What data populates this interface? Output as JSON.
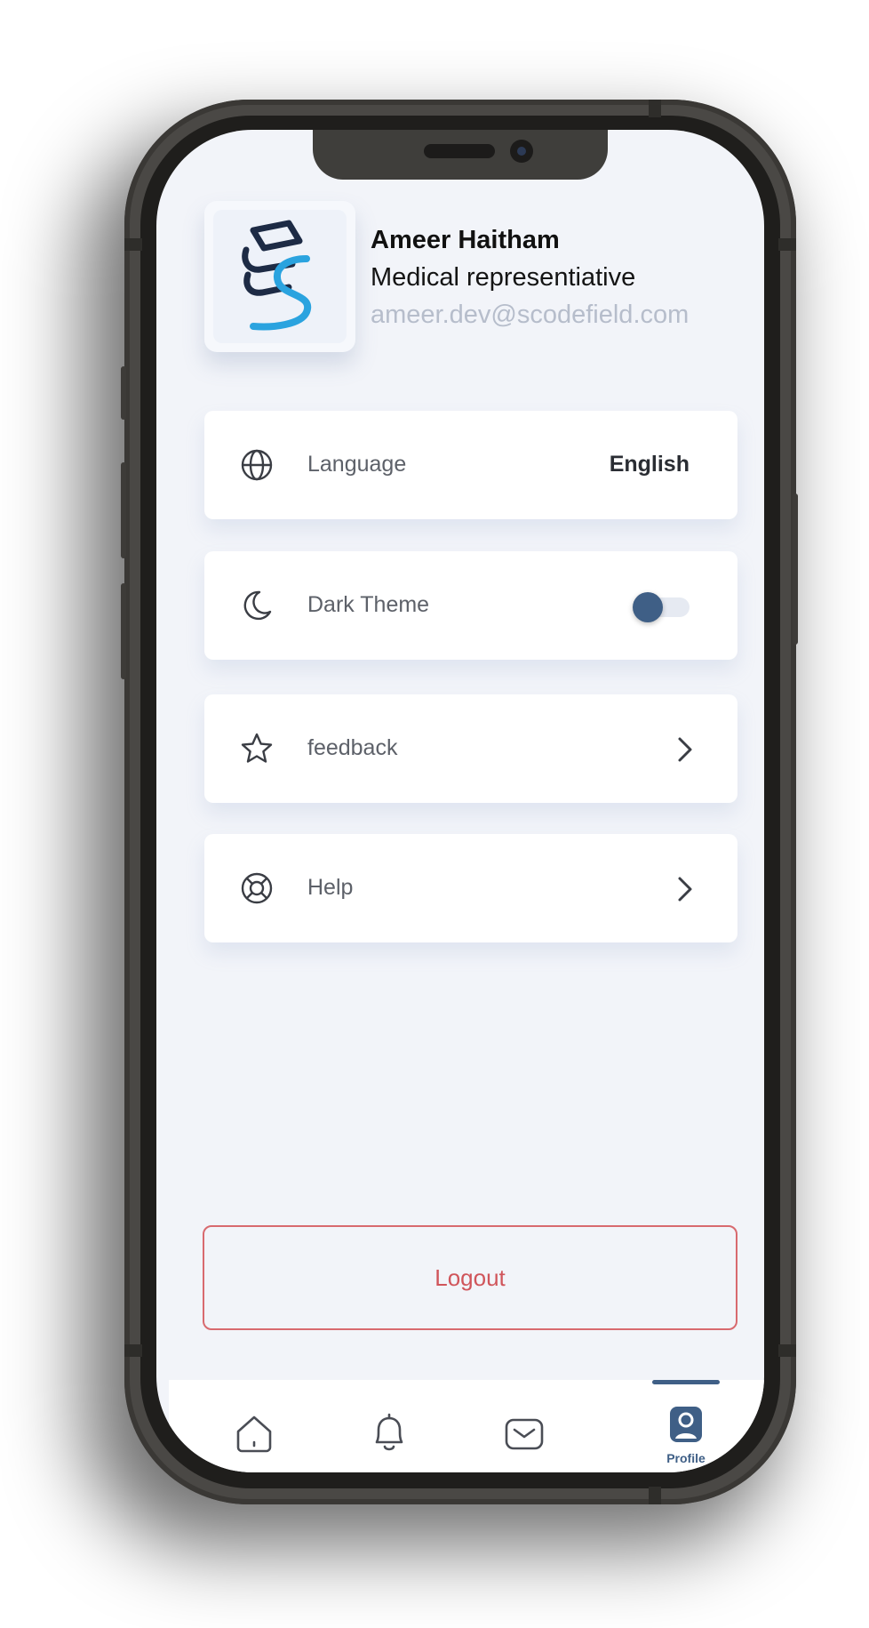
{
  "profile": {
    "name": "Ameer Haitham",
    "role": "Medical representiative",
    "email": "ameer.dev@scodefield.com"
  },
  "settings": [
    {
      "label": "Language",
      "value": "English",
      "icon": "globe-icon"
    },
    {
      "label": "Dark Theme",
      "icon": "moon-icon",
      "toggle_on": false
    },
    {
      "label": "feedback",
      "icon": "star-icon"
    },
    {
      "label": "Help",
      "icon": "lifebuoy-icon"
    }
  ],
  "logout_label": "Logout",
  "tabbar": {
    "active": "profile",
    "profile_label": "Profile",
    "tabs": [
      "home-icon",
      "bell-icon",
      "mail-icon",
      "profile-icon"
    ]
  },
  "colors": {
    "accent": "#3f5f86",
    "logout": "#d0555b",
    "screen_bg": "#f2f4f9"
  }
}
